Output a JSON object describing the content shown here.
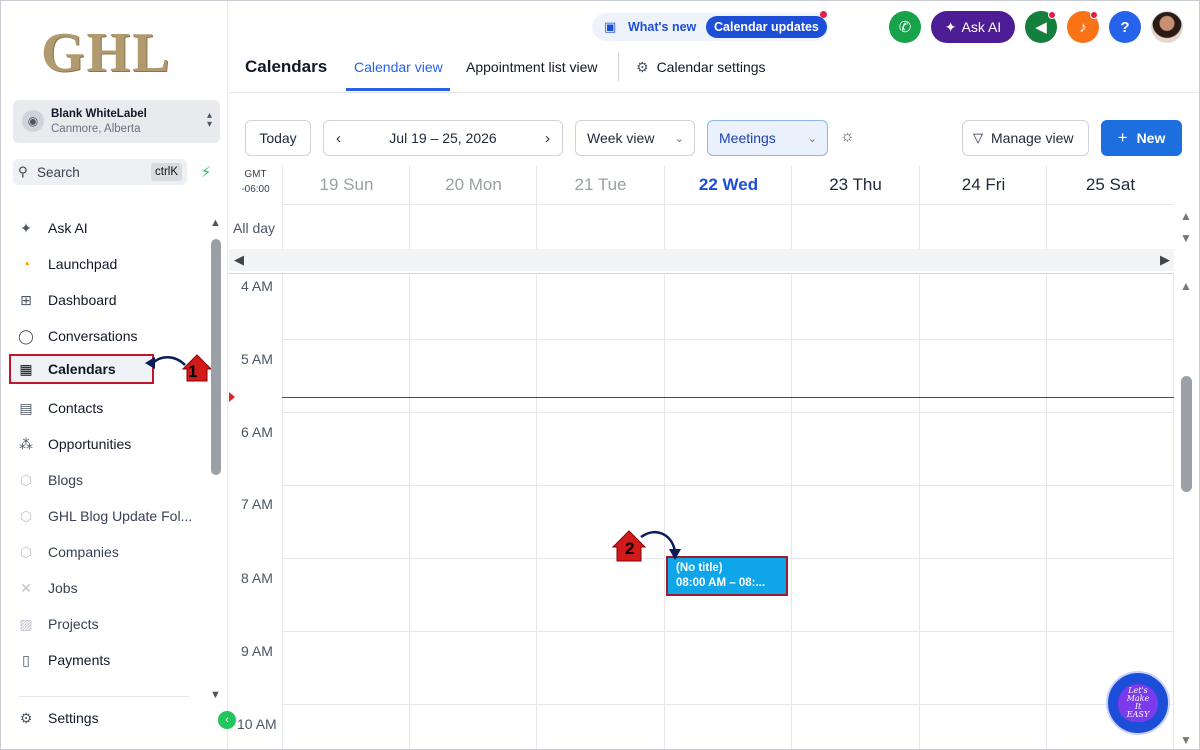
{
  "sidebar": {
    "logo_text": "GHL",
    "account": {
      "name": "Blank WhiteLabel",
      "location": "Canmore, Alberta"
    },
    "search": {
      "label": "Search",
      "shortcut": "ctrlK"
    },
    "items": [
      {
        "label": "Ask AI",
        "icon": "sparkle-icon"
      },
      {
        "label": "Launchpad",
        "icon": "rocket-icon"
      },
      {
        "label": "Dashboard",
        "icon": "grid-icon"
      },
      {
        "label": "Conversations",
        "icon": "chat-bubble-icon"
      },
      {
        "label": "Calendars",
        "icon": "calendar-icon",
        "active": true
      },
      {
        "label": "Contacts",
        "icon": "contacts-book-icon"
      },
      {
        "label": "Opportunities",
        "icon": "network-icon"
      },
      {
        "label": "Blogs",
        "icon": "cube-icon"
      },
      {
        "label": "GHL Blog Update Fol...",
        "icon": "cube-icon"
      },
      {
        "label": "Companies",
        "icon": "cube-icon"
      },
      {
        "label": "Jobs",
        "icon": "tools-icon"
      },
      {
        "label": "Projects",
        "icon": "chart-icon"
      },
      {
        "label": "Payments",
        "icon": "invoice-icon"
      }
    ],
    "settings_label": "Settings"
  },
  "header": {
    "whats_new": "What's new",
    "calendar_updates": "Calendar updates",
    "ask_ai": "Ask AI",
    "title": "Calendars",
    "tabs": [
      {
        "label": "Calendar view",
        "active": true
      },
      {
        "label": "Appointment list view"
      },
      {
        "label": "Calendar settings"
      }
    ]
  },
  "toolbar": {
    "today": "Today",
    "date_range": "Jul 19 – 25, 2026",
    "view_select": "Week view",
    "type_select": "Meetings",
    "manage_view": "Manage view",
    "new": "New"
  },
  "calendar": {
    "tz_line1": "GMT",
    "tz_line2": "-06:00",
    "all_day": "All day",
    "days": [
      "19 Sun",
      "20 Mon",
      "21 Tue",
      "22 Wed",
      "23 Thu",
      "24 Fri",
      "25 Sat"
    ],
    "today_index": 3,
    "hours": [
      "4 AM",
      "5 AM",
      "6 AM",
      "7 AM",
      "8 AM",
      "9 AM",
      "10 AM"
    ],
    "event": {
      "title": "(No title)",
      "time": "08:00 AM – 08:..."
    }
  },
  "annotations": {
    "step1": "1",
    "step2": "2"
  },
  "helper_badge": {
    "line1": "Let's Make",
    "line2": "It",
    "line3": "EASY"
  },
  "colors": {
    "accent": "#1d6fe0",
    "event": "#0ea5e9",
    "now_line": "#b91c1c",
    "highlight": "#c0162b"
  }
}
